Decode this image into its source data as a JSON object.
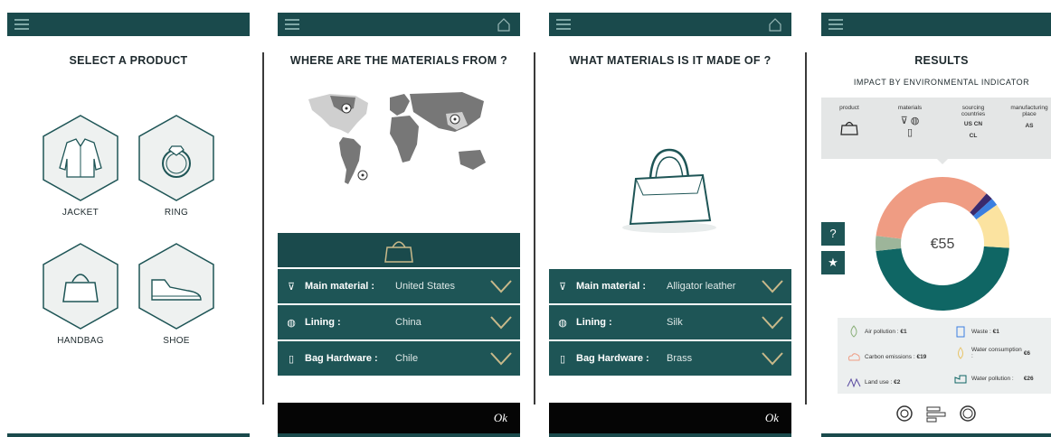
{
  "panel1": {
    "title": "SELECT A PRODUCT",
    "products": [
      {
        "label": "JACKET"
      },
      {
        "label": "RING"
      },
      {
        "label": "HANDBAG"
      },
      {
        "label": "SHOE"
      }
    ]
  },
  "panel2": {
    "title": "WHERE ARE THE MATERIALS FROM ?",
    "rows": [
      {
        "label": "Main material :",
        "value": "United States"
      },
      {
        "label": "Lining :",
        "value": "China"
      },
      {
        "label": "Bag Hardware :",
        "value": "Chile"
      }
    ],
    "ok": "Ok"
  },
  "panel3": {
    "title": "WHAT MATERIALS IS IT MADE OF ?",
    "rows": [
      {
        "label": "Main material :",
        "value": "Alligator leather"
      },
      {
        "label": "Lining :",
        "value": "Silk"
      },
      {
        "label": "Bag Hardware :",
        "value": "Brass"
      }
    ],
    "ok": "Ok"
  },
  "panel4": {
    "title": "RESULTS",
    "subtitle": "IMPACT BY ENVIRONMENTAL INDICATOR",
    "columns": {
      "product": "product",
      "materials": "materials",
      "sourcing": "sourcing countries",
      "manufacturing": "manufacturing place"
    },
    "countries": {
      "c1": "US",
      "c2": "CN",
      "c3": "CL",
      "place": "AS"
    },
    "total": "€55",
    "help": "?",
    "legend": [
      {
        "label": "Air pollution :",
        "value": "€1"
      },
      {
        "label": "Waste :",
        "value": "€1"
      },
      {
        "label": "Carbon emissions :",
        "value": "€19"
      },
      {
        "label": "Water consumption :",
        "value": "€6"
      },
      {
        "label": "Land use :",
        "value": "€2"
      },
      {
        "label": "Water pollution :",
        "value": "€26"
      }
    ]
  },
  "chart_data": {
    "type": "pie",
    "center_label": "€55",
    "slices": [
      {
        "name": "Water pollution",
        "value": 26,
        "color": "#0f6664"
      },
      {
        "name": "Land use",
        "value": 2,
        "color": "#9db59a"
      },
      {
        "name": "Carbon emissions",
        "value": 19,
        "color": "#ef9c83"
      },
      {
        "name": "Air pollution",
        "value": 1,
        "color": "#3a2a6e"
      },
      {
        "name": "Waste",
        "value": 1,
        "color": "#3b7fe0"
      },
      {
        "name": "Water consumption",
        "value": 6,
        "color": "#fbe3a0"
      }
    ]
  }
}
